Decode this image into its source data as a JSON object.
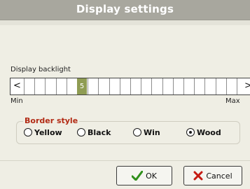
{
  "dialog": {
    "title": "Display settings"
  },
  "backlight": {
    "label": "Display backlight",
    "value": "5",
    "left_arrow": "<",
    "right_arrow": ">",
    "min_label": "Min",
    "max_label": "Max"
  },
  "border_style": {
    "legend": "Border style",
    "options": [
      {
        "label": "Yellow",
        "selected": false
      },
      {
        "label": "Black",
        "selected": false
      },
      {
        "label": "Win",
        "selected": false
      },
      {
        "label": "Wood",
        "selected": true
      }
    ]
  },
  "buttons": {
    "ok_label": "OK",
    "cancel_label": "Cancel"
  },
  "colors": {
    "titlebar": "#a8a79e",
    "background": "#efeee4",
    "slider_thumb": "#8f9c53",
    "legend_text": "#b22a14",
    "ok_check": "#2f8f1a",
    "cancel_x": "#c51a12"
  },
  "icons": {
    "ok": "check-icon",
    "cancel": "x-icon"
  }
}
